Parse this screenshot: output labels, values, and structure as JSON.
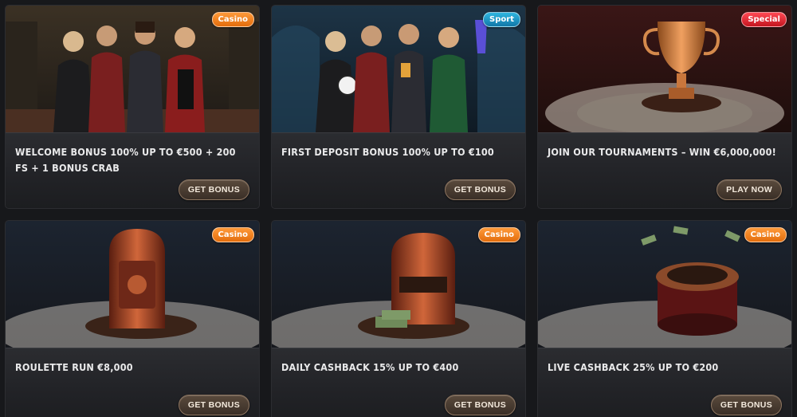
{
  "colors": {
    "casino_badge": "#f0821f",
    "sport_badge": "#1b97c8",
    "special_badge": "#e52630",
    "card_background": "#1f2024",
    "button_border": "#8d7560"
  },
  "cards": [
    {
      "badge": "Casino",
      "title": "Welcome Bonus 100% up to €500 + 200 FS + 1 Bonus Crab",
      "button": "GET BONUS",
      "image": "four-hosts-casino-scene"
    },
    {
      "badge": "Sport",
      "title": "First Deposit Bonus 100% up to €100",
      "button": "GET BONUS",
      "image": "four-hosts-sport-scene"
    },
    {
      "badge": "Special",
      "title": "Join our tournaments – Win €6,000,000!",
      "button": "PLAY NOW",
      "image": "golden-trophy-scene"
    },
    {
      "badge": "Casino",
      "title": "Roulette Run €8,000",
      "button": "GET BONUS",
      "image": "copper-safe-cabinet-scene"
    },
    {
      "badge": "Casino",
      "title": "Daily Cashback 15% up to €400",
      "button": "GET BONUS",
      "image": "slot-machine-cash-scene"
    },
    {
      "badge": "Casino",
      "title": "Live Cashback 25% up to €200",
      "button": "GET BONUS",
      "image": "roulette-wheel-cash-scene"
    }
  ]
}
